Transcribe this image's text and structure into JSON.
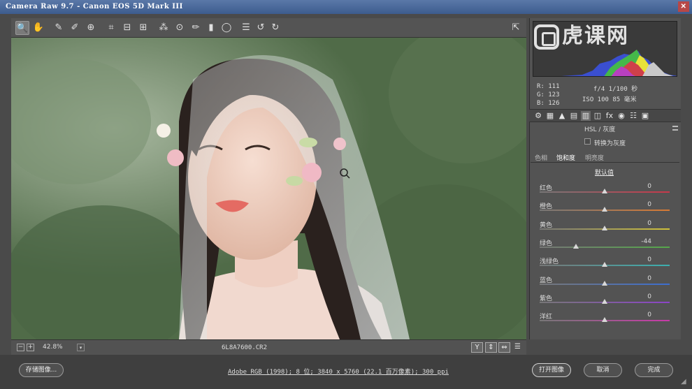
{
  "window": {
    "title": "Camera Raw 9.7 -  Canon EOS 5D Mark III"
  },
  "toolbar": {
    "tools": [
      {
        "name": "zoom-tool",
        "glyph": "🔍"
      },
      {
        "name": "hand-tool",
        "glyph": "✋"
      },
      {
        "name": "white-balance-tool",
        "glyph": "✎"
      },
      {
        "name": "color-sampler-tool",
        "glyph": "✐"
      },
      {
        "name": "targeted-adjustment-tool",
        "glyph": "⊕"
      },
      {
        "name": "crop-tool",
        "glyph": "⌗"
      },
      {
        "name": "straighten-tool",
        "glyph": "⊟"
      },
      {
        "name": "transform-tool",
        "glyph": "⊞"
      },
      {
        "name": "spot-removal-tool",
        "glyph": "⁂"
      },
      {
        "name": "red-eye-tool",
        "glyph": "⊙"
      },
      {
        "name": "adjustment-brush-tool",
        "glyph": "✏"
      },
      {
        "name": "graduated-filter-tool",
        "glyph": "▮"
      },
      {
        "name": "radial-filter-tool",
        "glyph": "◯"
      },
      {
        "name": "preferences-tool",
        "glyph": "☰"
      },
      {
        "name": "rotate-ccw-tool",
        "glyph": "↺"
      },
      {
        "name": "rotate-cw-tool",
        "glyph": "↻"
      }
    ],
    "fullscreen_glyph": "⇱"
  },
  "status": {
    "zoom_out": "−",
    "zoom_in": "+",
    "zoom_level": "42.8%",
    "zoom_dropdown": "▾",
    "filename": "6L8A7600.CR2",
    "view_icons": [
      "Y",
      "⇕",
      "⇔",
      "☰"
    ]
  },
  "readout": {
    "r": "R:  111",
    "g": "G:  123",
    "b": "B:  126",
    "exposure": "f/4   1/100 秒",
    "iso": "ISO 100   85 毫米"
  },
  "panel_tabs": [
    "⚙",
    "▦",
    "▲",
    "▤",
    "▥",
    "◫",
    "fx",
    "◉",
    "☷",
    "▣"
  ],
  "hsl": {
    "title": "HSL / 灰度",
    "convert_grayscale": "转换为灰度",
    "tabs": [
      "色相",
      "饱和度",
      "明亮度"
    ],
    "active_tab": "饱和度",
    "default_label": "默认值",
    "sliders": [
      {
        "label": "红色",
        "value": "0",
        "num": 0,
        "color": "#c8384a"
      },
      {
        "label": "橙色",
        "value": "0",
        "num": 0,
        "color": "#d77a34"
      },
      {
        "label": "黄色",
        "value": "0",
        "num": 0,
        "color": "#d0c23a"
      },
      {
        "label": "绿色",
        "value": "-44",
        "num": -44,
        "color": "#55a84a"
      },
      {
        "label": "浅绿色",
        "value": "0",
        "num": 0,
        "color": "#3bb0b0"
      },
      {
        "label": "蓝色",
        "value": "0",
        "num": 0,
        "color": "#3c6ed0"
      },
      {
        "label": "紫色",
        "value": "0",
        "num": 0,
        "color": "#8c44c8"
      },
      {
        "label": "洋红",
        "value": "0",
        "num": 0,
        "color": "#c83aa8"
      }
    ]
  },
  "bottom": {
    "save_label": "存储图像...",
    "workflow_link": "Adobe RGB (1998); 8 位; 3840 x 5760 (22.1 百万像素); 300 ppi",
    "open_label": "打开图像",
    "cancel_label": "取消",
    "done_label": "完成"
  },
  "watermark": {
    "text": "虎课网"
  }
}
